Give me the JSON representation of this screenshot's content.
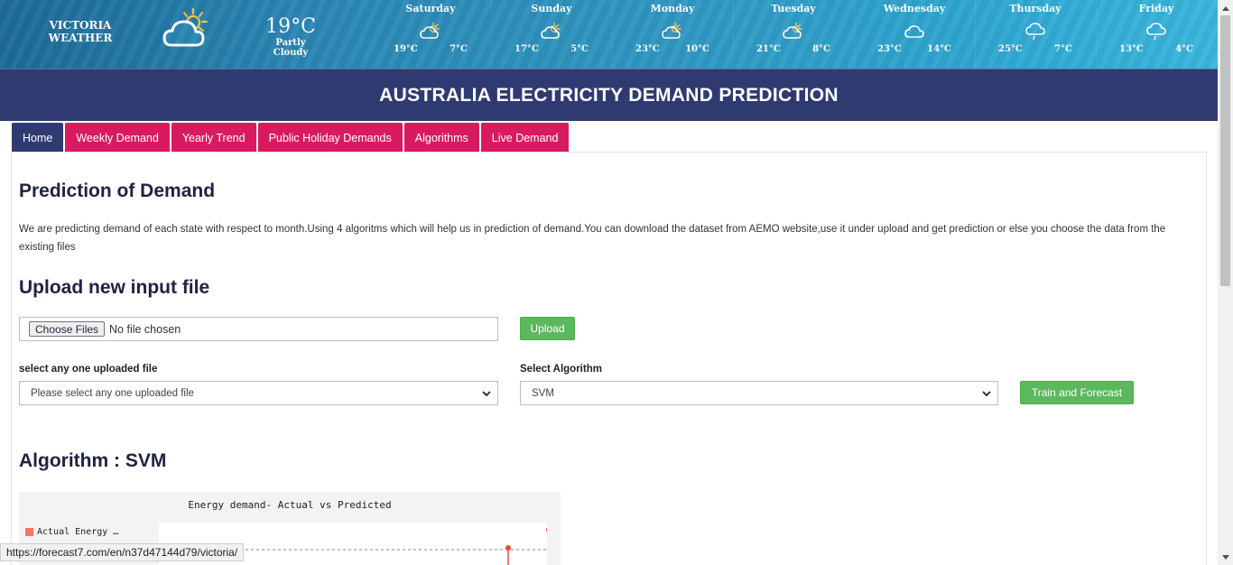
{
  "weather": {
    "city_line1": "VICTORIA",
    "city_line2": "WEATHER",
    "current_icon": "partly-cloudy-sun-icon",
    "current_temp": "19°C",
    "current_condition": "Partly Cloudy",
    "days": [
      {
        "name": "Saturday",
        "high": "19°C",
        "low": "7°C",
        "icon": "partly-cloudy-icon"
      },
      {
        "name": "Sunday",
        "high": "17°C",
        "low": "5°C",
        "icon": "partly-cloudy-icon"
      },
      {
        "name": "Monday",
        "high": "23°C",
        "low": "10°C",
        "icon": "partly-cloudy-icon"
      },
      {
        "name": "Tuesday",
        "high": "21°C",
        "low": "8°C",
        "icon": "partly-cloudy-icon"
      },
      {
        "name": "Wednesday",
        "high": "23°C",
        "low": "14°C",
        "icon": "cloud-icon"
      },
      {
        "name": "Thursday",
        "high": "25°C",
        "low": "7°C",
        "icon": "rain-cloud-icon"
      },
      {
        "name": "Friday",
        "high": "13°C",
        "low": "4°C",
        "icon": "rain-cloud-icon"
      }
    ]
  },
  "header": {
    "title": "AUSTRALIA ELECTRICITY DEMAND PREDICTION"
  },
  "tabs": [
    {
      "label": "Home",
      "active": true
    },
    {
      "label": "Weekly Demand",
      "active": false
    },
    {
      "label": "Yearly Trend",
      "active": false
    },
    {
      "label": "Public Holiday Demands",
      "active": false
    },
    {
      "label": "Algorithms",
      "active": false
    },
    {
      "label": "Live Demand",
      "active": false
    }
  ],
  "main": {
    "heading": "Prediction of Demand",
    "description": "We are predicting demand of each state with respect to month.Using 4 algoritms which will help us in prediction of demand.You can download the dataset from AEMO website,use it under upload and get prediction or else you choose the data from the existing files",
    "upload_heading": "Upload new input file",
    "choose_files_label": "Choose Files",
    "no_file_text": "No file chosen",
    "upload_button": "Upload",
    "select_file_label": "select any one uploaded file",
    "select_file_value": "Please select any one uploaded file",
    "select_algorithm_label": "Select Algorithm",
    "select_algorithm_value": "SVM",
    "train_button": "Train and Forecast",
    "algorithm_heading": "Algorithm : SVM"
  },
  "chart_data": {
    "type": "line",
    "title": "Energy demand- Actual vs Predicted",
    "series": [
      {
        "name": "Actual Energy …",
        "color": "#f4736a"
      }
    ]
  },
  "status_bar": {
    "url": "https://forecast7.com/en/n37d47144d79/victoria/"
  },
  "colors": {
    "nav": "#2f3b70",
    "tab": "#d81b60",
    "button": "#5cb85c"
  }
}
